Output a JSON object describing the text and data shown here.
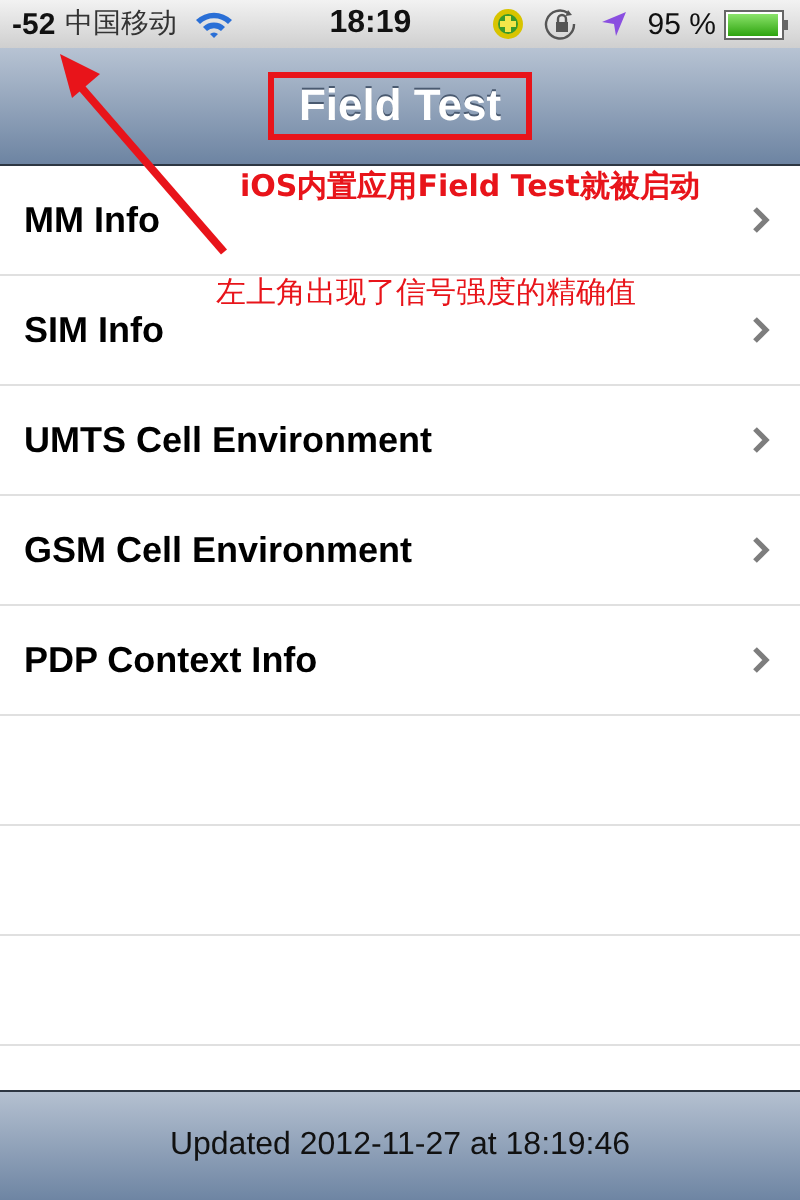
{
  "status_bar": {
    "signal": "-52",
    "carrier": "中国移动",
    "time": "18:19",
    "battery": "95 %"
  },
  "nav_bar": {
    "title": "Field Test"
  },
  "rows": [
    {
      "label": "MM Info"
    },
    {
      "label": "SIM Info"
    },
    {
      "label": "UMTS Cell Environment"
    },
    {
      "label": "GSM Cell Environment"
    },
    {
      "label": "PDP Context Info"
    }
  ],
  "toolbar": {
    "text": "Updated 2012-11-27 at 18:19:46"
  },
  "annotations": [
    "iOS内置应用Field Test就被启动",
    "左上角出现了信号强度的精确值"
  ]
}
